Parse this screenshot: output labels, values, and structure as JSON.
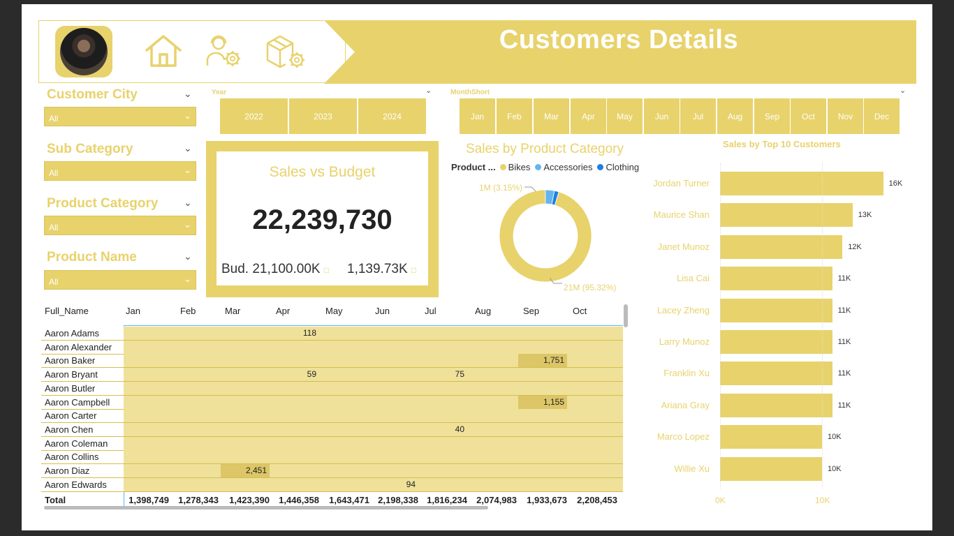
{
  "header": {
    "title": "Customers Details",
    "icons": [
      "avatar-photo",
      "home-icon",
      "support-agent-settings-icon",
      "package-settings-icon"
    ]
  },
  "colors": {
    "accent": "#e8d26b",
    "bikes": "#e8d26b",
    "accessories": "#63b5f0",
    "clothing": "#1f7fe0",
    "background": "#ffffff",
    "frame": "#2b2b2b"
  },
  "slicers": {
    "customer_city": {
      "title": "Customer City",
      "value": "All"
    },
    "sub_category": {
      "title": "Sub Category",
      "value": "All"
    },
    "product_category": {
      "title": "Product Category",
      "value": "All"
    },
    "product_name": {
      "title": "Product Name",
      "value": "All"
    }
  },
  "year_slicer": {
    "title": "Year",
    "options": [
      "2022",
      "2023",
      "2024"
    ]
  },
  "month_slicer": {
    "title": "MonthShort",
    "options": [
      "Jan",
      "Feb",
      "Mar",
      "Apr",
      "May",
      "Jun",
      "Jul",
      "Aug",
      "Sep",
      "Oct",
      "Nov",
      "Dec"
    ]
  },
  "kpi": {
    "title": "Sales vs Budget",
    "value": "22,239,730",
    "budget": "Bud. 21,100.00K",
    "diff": "1,139.73K"
  },
  "donut": {
    "title": "Sales by Product Category",
    "legend_title": "Product ...",
    "legend": [
      "Bikes",
      "Accessories",
      "Clothing"
    ],
    "label_small": "1M (3.15%)",
    "label_large": "21M (95.32%)"
  },
  "top_customers": {
    "title": "Sales by Top 10 Customers",
    "axis": [
      "0K",
      "10K"
    ]
  },
  "matrix": {
    "headers": [
      "Full_Name",
      "Jan",
      "Feb",
      "Mar",
      "Apr",
      "May",
      "Jun",
      "Jul",
      "Aug",
      "Sep",
      "Oct"
    ],
    "rows": [
      {
        "name": "Aaron Adams"
      },
      {
        "name": "Aaron Alexander"
      },
      {
        "name": "Aaron Baker"
      },
      {
        "name": "Aaron Bryant"
      },
      {
        "name": "Aaron Butler"
      },
      {
        "name": "Aaron Campbell"
      },
      {
        "name": "Aaron Carter"
      },
      {
        "name": "Aaron Chen"
      },
      {
        "name": "Aaron Coleman"
      },
      {
        "name": "Aaron Collins"
      },
      {
        "name": "Aaron Diaz"
      },
      {
        "name": "Aaron Edwards"
      }
    ],
    "cells": [
      {
        "row": 0,
        "month": "Apr",
        "value": "118"
      },
      {
        "row": 2,
        "month": "Sep",
        "value": "1,751"
      },
      {
        "row": 3,
        "month": "Apr",
        "value": "59"
      },
      {
        "row": 3,
        "month": "Jul",
        "value": "75"
      },
      {
        "row": 5,
        "month": "Sep",
        "value": "1,155"
      },
      {
        "row": 7,
        "month": "Jul",
        "value": "40"
      },
      {
        "row": 10,
        "month": "Mar",
        "value": "2,451"
      },
      {
        "row": 11,
        "month": "Jun",
        "value": "94"
      }
    ],
    "total_label": "Total",
    "totals": [
      "1,398,749",
      "1,278,343",
      "1,423,390",
      "1,446,358",
      "1,643,471",
      "2,198,338",
      "1,816,234",
      "2,074,983",
      "1,933,673",
      "2,208,453"
    ]
  },
  "chart_data": [
    {
      "type": "pie",
      "title": "Sales by Product Category",
      "legend_title": "Product ...",
      "categories": [
        "Bikes",
        "Accessories",
        "Clothing"
      ],
      "values": [
        95.32,
        3.15,
        1.53
      ],
      "value_labels": [
        "21M (95.32%)",
        "1M (3.15%)",
        ""
      ],
      "colors": [
        "#e8d26b",
        "#63b5f0",
        "#1f7fe0"
      ],
      "legend_position": "top"
    },
    {
      "type": "bar",
      "orientation": "horizontal",
      "title": "Sales by Top 10 Customers",
      "categories": [
        "Jordan Turner",
        "Maurice Shan",
        "Janet Munoz",
        "Lisa Cai",
        "Lacey Zheng",
        "Larry Munoz",
        "Franklin Xu",
        "Ariana Gray",
        "Marco Lopez",
        "Willie Xu"
      ],
      "values": [
        16,
        13,
        12,
        11,
        11,
        11,
        11,
        11,
        10,
        10
      ],
      "value_labels": [
        "16K",
        "13K",
        "12K",
        "11K",
        "11K",
        "11K",
        "11K",
        "11K",
        "10K",
        "10K"
      ],
      "xlim": [
        0,
        17
      ],
      "xticks": [
        "0K",
        "10K"
      ],
      "grid": true
    }
  ]
}
